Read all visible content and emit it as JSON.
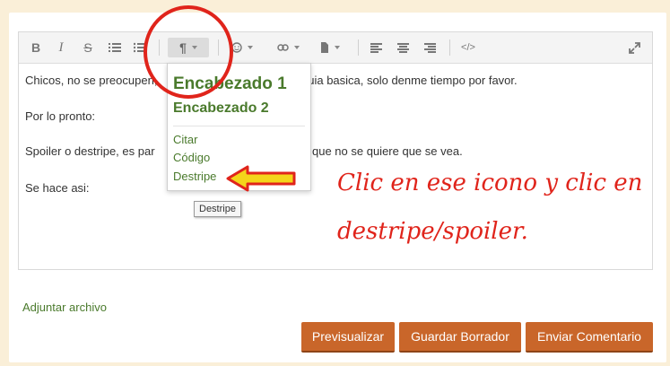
{
  "toolbar": {
    "items": [
      "bold-icon",
      "italic-icon",
      "strikethrough-icon",
      "ordered-list-icon",
      "unordered-list-icon",
      "paragraph-icon",
      "emoji-icon",
      "link-icon",
      "file-icon",
      "align-left-icon",
      "align-center-icon",
      "align-right-icon",
      "code-icon",
      "fullscreen-icon"
    ],
    "paragraph_glyph": "¶"
  },
  "editor": {
    "lines": [
      "Chicos, no se preocupen,",
      "guia basica, solo denme tiempo por favor.",
      "Por lo pronto:",
      "Spoiler o destripe, es par",
      "que no se quiere que se vea.",
      "Se hace asi:"
    ]
  },
  "dropdown": {
    "heading1": "Encabezado 1",
    "heading2": "Encabezado 2",
    "items": [
      "Citar",
      "Código",
      "Destripe"
    ]
  },
  "tooltip": "Destripe",
  "annotation": {
    "line1": "Clic en ese icono y clic en",
    "line2": "destripe/spoiler."
  },
  "attach_label": "Adjuntar archivo",
  "buttons": {
    "preview": "Previsualizar",
    "save_draft": "Guardar Borrador",
    "submit": "Enviar Comentario"
  },
  "colors": {
    "accent_green": "#4a7a2c",
    "button_orange": "#c9662a",
    "annotation_red": "#e0241b",
    "page_bg": "#faefd8"
  }
}
